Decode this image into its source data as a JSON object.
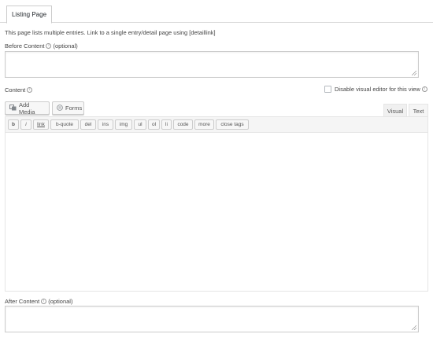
{
  "tabs": {
    "active_label": "Listing Page"
  },
  "description": "This page lists multiple entries. Link to a single entry/detail page using [detaillink]",
  "before_content": {
    "label": "Before Content",
    "optional": "(optional)"
  },
  "content": {
    "label": "Content"
  },
  "disable_visual": {
    "label": "Disable visual editor for this view"
  },
  "media_buttons": {
    "add_media": "Add Media",
    "forms": "Forms"
  },
  "editor_modes": {
    "visual": "Visual",
    "text": "Text"
  },
  "quicktags": [
    "b",
    "i",
    "link",
    "b-quote",
    "del",
    "ins",
    "img",
    "ul",
    "ol",
    "li",
    "code",
    "more",
    "close tags"
  ],
  "after_content": {
    "label": "After Content",
    "optional": "(optional)"
  }
}
